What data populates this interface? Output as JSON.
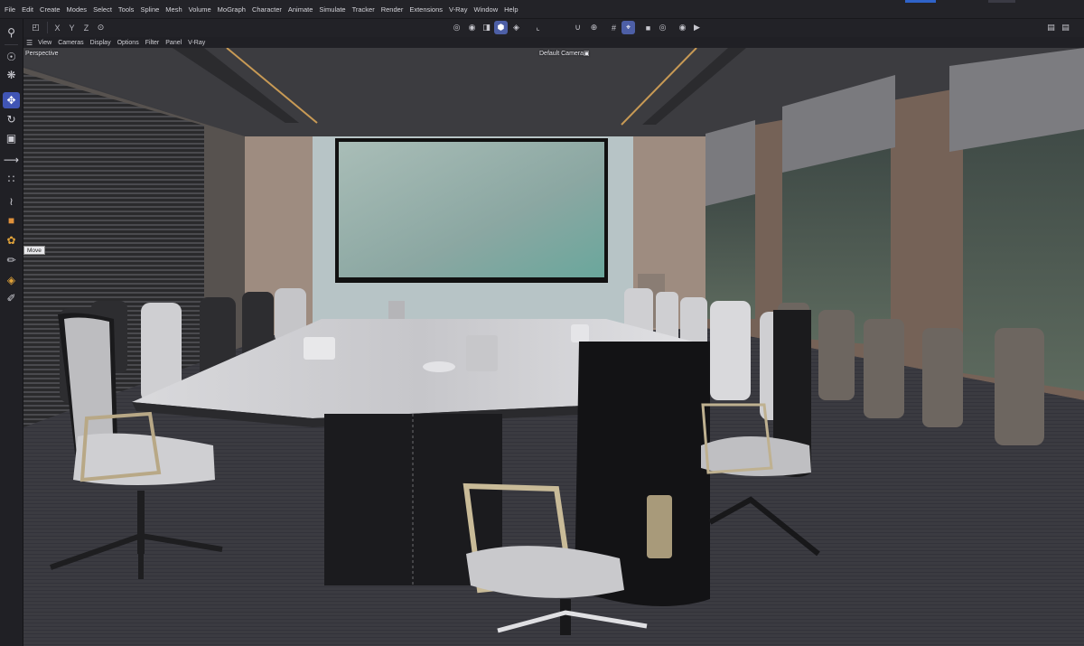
{
  "menubar": {
    "items": [
      "File",
      "Edit",
      "Create",
      "Modes",
      "Select",
      "Tools",
      "Spline",
      "Mesh",
      "Volume",
      "MoGraph",
      "Character",
      "Animate",
      "Simulate",
      "Tracker",
      "Render",
      "Extensions",
      "V-Ray",
      "Window",
      "Help"
    ]
  },
  "toolbar": {
    "axis_x": "X",
    "axis_y": "Y",
    "axis_z": "Z"
  },
  "lefttools": {
    "move_tooltip": "Move"
  },
  "viewport_menu": {
    "items": [
      "View",
      "Cameras",
      "Display",
      "Options",
      "Filter",
      "Panel",
      "V-Ray"
    ]
  },
  "viewport": {
    "projection": "Perspective",
    "camera": "Default Camera"
  },
  "colors": {
    "active_tool": "#4055b5",
    "accent": "#2f63c9",
    "ui_background": "#1d1d21"
  },
  "icons": [
    "search-icon",
    "camera-icon",
    "move-icon",
    "rotate-icon",
    "scale-icon",
    "render-icon",
    "undo-icon"
  ]
}
